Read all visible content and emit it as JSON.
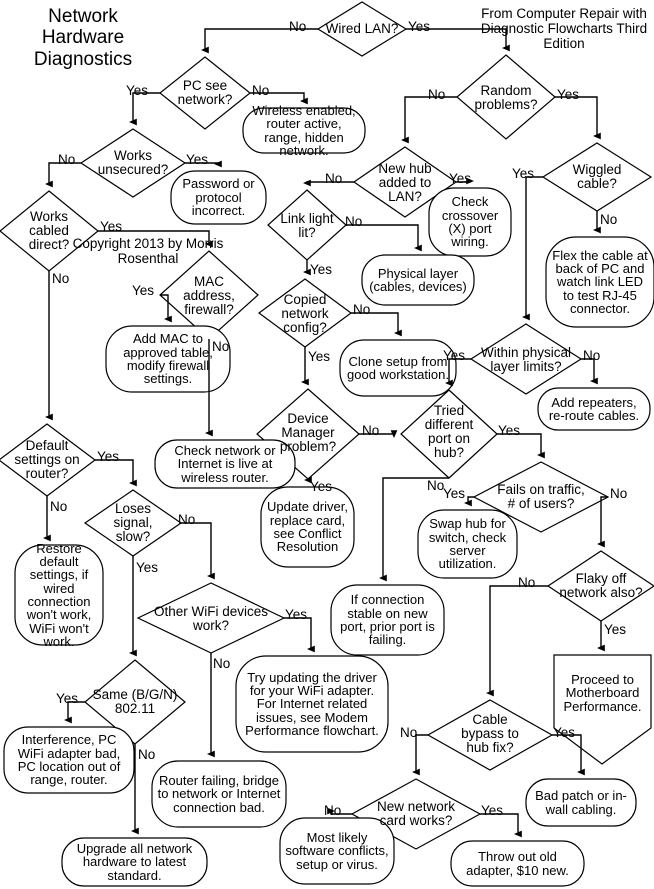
{
  "title": "Network Hardware Diagnostics",
  "source_note": "From Computer Repair with Diagnostic Flowcharts Third Edition",
  "copyright": "Copyright 2013 by Morris Rosenthal",
  "colors": {
    "stroke": "#000000",
    "fill": "#ffffff",
    "text": "#000000"
  },
  "chart_data": {
    "type": "diagram",
    "diagram_type": "flowchart",
    "title": "Network Hardware Diagnostics",
    "nodes": [
      {
        "id": "wired_lan",
        "shape": "decision",
        "text": "Wired LAN?"
      },
      {
        "id": "pc_see_network",
        "shape": "decision",
        "text": "PC see network?"
      },
      {
        "id": "wireless_enabled",
        "shape": "terminal",
        "text": "Wireless enabled, router active, range, hidden network."
      },
      {
        "id": "works_unsecured",
        "shape": "decision",
        "text": "Works unsecured?"
      },
      {
        "id": "password",
        "shape": "terminal",
        "text": "Password or protocol incorrect."
      },
      {
        "id": "works_cabled",
        "shape": "decision",
        "text": "Works cabled direct?"
      },
      {
        "id": "mac_firewall",
        "shape": "decision",
        "text": "MAC address, firewall?"
      },
      {
        "id": "add_mac",
        "shape": "terminal",
        "text": "Add MAC to approved table, modify firewall settings."
      },
      {
        "id": "check_network",
        "shape": "terminal",
        "text": "Check network or Internet is live at wireless router."
      },
      {
        "id": "default_settings",
        "shape": "decision",
        "text": "Default settings on router?"
      },
      {
        "id": "restore_default",
        "shape": "terminal",
        "text": "Restore default settings, if wired connection won't work, WiFi won't work."
      },
      {
        "id": "loses_signal",
        "shape": "decision",
        "text": "Loses signal, slow?"
      },
      {
        "id": "other_wifi",
        "shape": "decision",
        "text": "Other WiFi devices work?"
      },
      {
        "id": "same_bgn",
        "shape": "decision",
        "text": "Same (B/G/N) 802.11"
      },
      {
        "id": "interference",
        "shape": "terminal",
        "text": "Interference, PC WiFi adapter bad, PC location out of range, router."
      },
      {
        "id": "upgrade_all",
        "shape": "terminal",
        "text": "Upgrade all network hardware to latest standard."
      },
      {
        "id": "router_failing",
        "shape": "terminal",
        "text": "Router failing, bridge to network or Internet connection bad."
      },
      {
        "id": "try_updating",
        "shape": "terminal",
        "text": "Try updating the driver for your WiFi adapter. For Internet related issues, see Modem Performance flowchart."
      },
      {
        "id": "random_problems",
        "shape": "decision",
        "text": "Random problems?"
      },
      {
        "id": "new_hub",
        "shape": "decision",
        "text": "New hub added to LAN?"
      },
      {
        "id": "check_crossover",
        "shape": "terminal",
        "text": "Check crossover (X) port wiring."
      },
      {
        "id": "link_light",
        "shape": "decision",
        "text": "Link light lit?"
      },
      {
        "id": "physical_layer",
        "shape": "terminal",
        "text": "Physical layer (cables, devices)"
      },
      {
        "id": "copied_config",
        "shape": "decision",
        "text": "Copied network config?"
      },
      {
        "id": "clone_setup",
        "shape": "terminal",
        "text": "Clone setup from good workstation."
      },
      {
        "id": "device_manager",
        "shape": "decision",
        "text": "Device Manager problem?"
      },
      {
        "id": "update_driver",
        "shape": "terminal",
        "text": "Update driver, replace card, see Conflict Resolution"
      },
      {
        "id": "tried_port",
        "shape": "decision",
        "text": "Tried different port on hub?"
      },
      {
        "id": "if_connection",
        "shape": "terminal",
        "text": "If connection stable on new port, prior port is failing."
      },
      {
        "id": "wiggled_cable",
        "shape": "decision",
        "text": "Wiggled cable?"
      },
      {
        "id": "flex_cable",
        "shape": "terminal",
        "text": "Flex the cable at back of PC and watch link LED to test RJ-45 connector."
      },
      {
        "id": "within_limits",
        "shape": "decision",
        "text": "Within physical layer limits?"
      },
      {
        "id": "add_repeaters",
        "shape": "terminal",
        "text": "Add repeaters, re-route cables."
      },
      {
        "id": "fails_traffic",
        "shape": "decision",
        "text": "Fails on traffic, # of users?"
      },
      {
        "id": "swap_hub",
        "shape": "terminal",
        "text": "Swap hub for switch, check server utilization."
      },
      {
        "id": "flaky_off",
        "shape": "decision",
        "text": "Flaky off network also?"
      },
      {
        "id": "proceed_mb",
        "shape": "pentagon",
        "text": "Proceed to Motherboard Performance."
      },
      {
        "id": "cable_bypass",
        "shape": "decision",
        "text": "Cable bypass to hub fix?"
      },
      {
        "id": "bad_patch",
        "shape": "terminal",
        "text": "Bad patch or in-wall cabling."
      },
      {
        "id": "new_card",
        "shape": "decision",
        "text": "New network card works?"
      },
      {
        "id": "most_likely",
        "shape": "terminal",
        "text": "Most likely software conflicts, setup or virus."
      },
      {
        "id": "throw_out",
        "shape": "terminal",
        "text": "Throw out old adapter, $10 new."
      }
    ],
    "edges": [
      {
        "from": "wired_lan",
        "to": "pc_see_network",
        "label": "No"
      },
      {
        "from": "wired_lan",
        "to": "random_problems",
        "label": "Yes"
      },
      {
        "from": "pc_see_network",
        "to": "works_unsecured",
        "label": "Yes"
      },
      {
        "from": "pc_see_network",
        "to": "wireless_enabled",
        "label": "No"
      },
      {
        "from": "works_unsecured",
        "to": "works_cabled",
        "label": "No"
      },
      {
        "from": "works_unsecured",
        "to": "password",
        "label": "Yes"
      },
      {
        "from": "works_cabled",
        "to": "mac_firewall",
        "label": "Yes"
      },
      {
        "from": "works_cabled",
        "to": "default_settings",
        "label": "No"
      },
      {
        "from": "mac_firewall",
        "to": "add_mac",
        "label": "Yes"
      },
      {
        "from": "mac_firewall",
        "to": "check_network",
        "label": "No"
      },
      {
        "from": "default_settings",
        "to": "loses_signal",
        "label": "Yes"
      },
      {
        "from": "default_settings",
        "to": "restore_default",
        "label": "No"
      },
      {
        "from": "loses_signal",
        "to": "same_bgn",
        "label": "Yes"
      },
      {
        "from": "loses_signal",
        "to": "other_wifi",
        "label": "No"
      },
      {
        "from": "same_bgn",
        "to": "interference",
        "label": "Yes"
      },
      {
        "from": "same_bgn",
        "to": "upgrade_all",
        "label": "No"
      },
      {
        "from": "other_wifi",
        "to": "try_updating",
        "label": "Yes"
      },
      {
        "from": "other_wifi",
        "to": "router_failing",
        "label": "No"
      },
      {
        "from": "random_problems",
        "to": "new_hub",
        "label": "No"
      },
      {
        "from": "random_problems",
        "to": "wiggled_cable",
        "label": "Yes"
      },
      {
        "from": "new_hub",
        "to": "link_light",
        "label": "No"
      },
      {
        "from": "new_hub",
        "to": "check_crossover",
        "label": "Yes"
      },
      {
        "from": "link_light",
        "to": "copied_config",
        "label": "Yes"
      },
      {
        "from": "link_light",
        "to": "physical_layer",
        "label": "No"
      },
      {
        "from": "copied_config",
        "to": "device_manager",
        "label": "Yes"
      },
      {
        "from": "copied_config",
        "to": "clone_setup",
        "label": "No"
      },
      {
        "from": "device_manager",
        "to": "update_driver",
        "label": "Yes"
      },
      {
        "from": "device_manager",
        "to": "tried_port",
        "label": "No"
      },
      {
        "from": "tried_port",
        "to": "fails_traffic",
        "label": "Yes"
      },
      {
        "from": "tried_port",
        "to": "if_connection",
        "label": "No"
      },
      {
        "from": "wiggled_cable",
        "to": "within_limits",
        "label": "Yes"
      },
      {
        "from": "wiggled_cable",
        "to": "flex_cable",
        "label": "No"
      },
      {
        "from": "within_limits",
        "to": "tried_port",
        "label": "Yes"
      },
      {
        "from": "within_limits",
        "to": "add_repeaters",
        "label": "No"
      },
      {
        "from": "fails_traffic",
        "to": "swap_hub",
        "label": "Yes"
      },
      {
        "from": "fails_traffic",
        "to": "flaky_off",
        "label": "No"
      },
      {
        "from": "flaky_off",
        "to": "proceed_mb",
        "label": "Yes"
      },
      {
        "from": "flaky_off",
        "to": "cable_bypass",
        "label": "No"
      },
      {
        "from": "cable_bypass",
        "to": "bad_patch",
        "label": "Yes"
      },
      {
        "from": "cable_bypass",
        "to": "new_card",
        "label": "No"
      },
      {
        "from": "new_card",
        "to": "throw_out",
        "label": "Yes"
      },
      {
        "from": "new_card",
        "to": "most_likely",
        "label": "No"
      }
    ]
  },
  "labels": {
    "wired_lan_no": "No",
    "wired_lan_yes": "Yes",
    "pc_see_yes": "Yes",
    "pc_see_no": "No",
    "unsecured_no": "No",
    "unsecured_yes": "Yes",
    "cabled_yes": "Yes",
    "cabled_no": "No",
    "mac_yes": "Yes",
    "mac_no": "No",
    "default_yes": "Yes",
    "default_no": "No",
    "loses_yes": "Yes",
    "loses_no": "No",
    "same_yes": "Yes",
    "same_no": "No",
    "otherwifi_yes": "Yes",
    "otherwifi_no": "No",
    "random_no": "No",
    "random_yes": "Yes",
    "newhub_no": "No",
    "newhub_yes": "Yes",
    "link_yes": "Yes",
    "link_no": "No",
    "copied_yes": "Yes",
    "copied_no": "No",
    "devmgr_yes": "Yes",
    "devmgr_no": "No",
    "tried_yes": "Yes",
    "tried_no": "No",
    "wiggled_yes": "Yes",
    "wiggled_no": "No",
    "within_yes": "Yes",
    "within_no": "No",
    "fails_yes": "Yes",
    "fails_no": "No",
    "flaky_no": "No",
    "flaky_yes": "Yes",
    "bypass_no": "No",
    "bypass_yes": "Yes",
    "newcard_no": "No",
    "newcard_yes": "Yes"
  }
}
